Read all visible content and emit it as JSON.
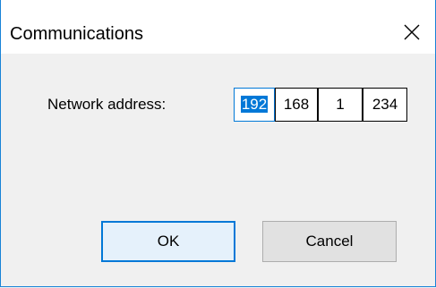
{
  "window": {
    "title": "Communications",
    "close_icon": "close-icon"
  },
  "form": {
    "network_address_label": "Network address:",
    "ip_octets": [
      "192",
      "168",
      "1",
      "234"
    ]
  },
  "buttons": {
    "ok_label": "OK",
    "cancel_label": "Cancel"
  },
  "colors": {
    "accent": "#0078d7",
    "window_border": "#1883d7"
  }
}
